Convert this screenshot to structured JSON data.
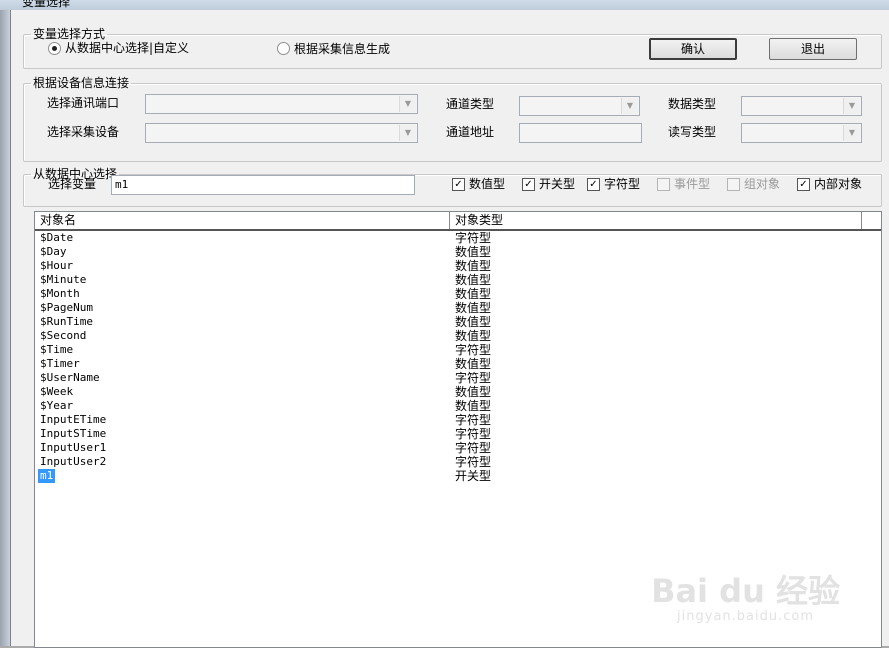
{
  "window": {
    "title": "变量选择"
  },
  "mode": {
    "legend": "变量选择方式",
    "option1": "从数据中心选择|自定义",
    "option2": "根据采集信息生成",
    "selected": "option1",
    "ok_label": "确认",
    "exit_label": "退出"
  },
  "device": {
    "legend": "根据设备信息连接",
    "port_label": "选择通讯端口",
    "device_label": "选择采集设备",
    "channel_type_label": "通道类型",
    "channel_addr_label": "通道地址",
    "data_type_label": "数据类型",
    "rw_type_label": "读写类型"
  },
  "datacenter": {
    "legend": "从数据中心选择",
    "var_label": "选择变量",
    "var_value": "m1",
    "filters": [
      {
        "label": "数值型",
        "checked": true,
        "enabled": true
      },
      {
        "label": "开关型",
        "checked": true,
        "enabled": true
      },
      {
        "label": "字符型",
        "checked": true,
        "enabled": true
      },
      {
        "label": "事件型",
        "checked": false,
        "enabled": false
      },
      {
        "label": "组对象",
        "checked": false,
        "enabled": false
      },
      {
        "label": "内部对象",
        "checked": true,
        "enabled": true
      }
    ]
  },
  "table": {
    "columns": [
      "对象名",
      "对象类型"
    ],
    "rows": [
      [
        "$Date",
        "字符型"
      ],
      [
        "$Day",
        "数值型"
      ],
      [
        "$Hour",
        "数值型"
      ],
      [
        "$Minute",
        "数值型"
      ],
      [
        "$Month",
        "数值型"
      ],
      [
        "$PageNum",
        "数值型"
      ],
      [
        "$RunTime",
        "数值型"
      ],
      [
        "$Second",
        "数值型"
      ],
      [
        "$Time",
        "字符型"
      ],
      [
        "$Timer",
        "数值型"
      ],
      [
        "$UserName",
        "字符型"
      ],
      [
        "$Week",
        "数值型"
      ],
      [
        "$Year",
        "数值型"
      ],
      [
        "InputETime",
        "字符型"
      ],
      [
        "InputSTime",
        "字符型"
      ],
      [
        "InputUser1",
        "字符型"
      ],
      [
        "InputUser2",
        "字符型"
      ],
      [
        "m1",
        "开关型"
      ]
    ],
    "selected_row": 17
  },
  "watermark": {
    "top": "Bai du 经验",
    "bottom": "jingyan.baidu.com"
  }
}
